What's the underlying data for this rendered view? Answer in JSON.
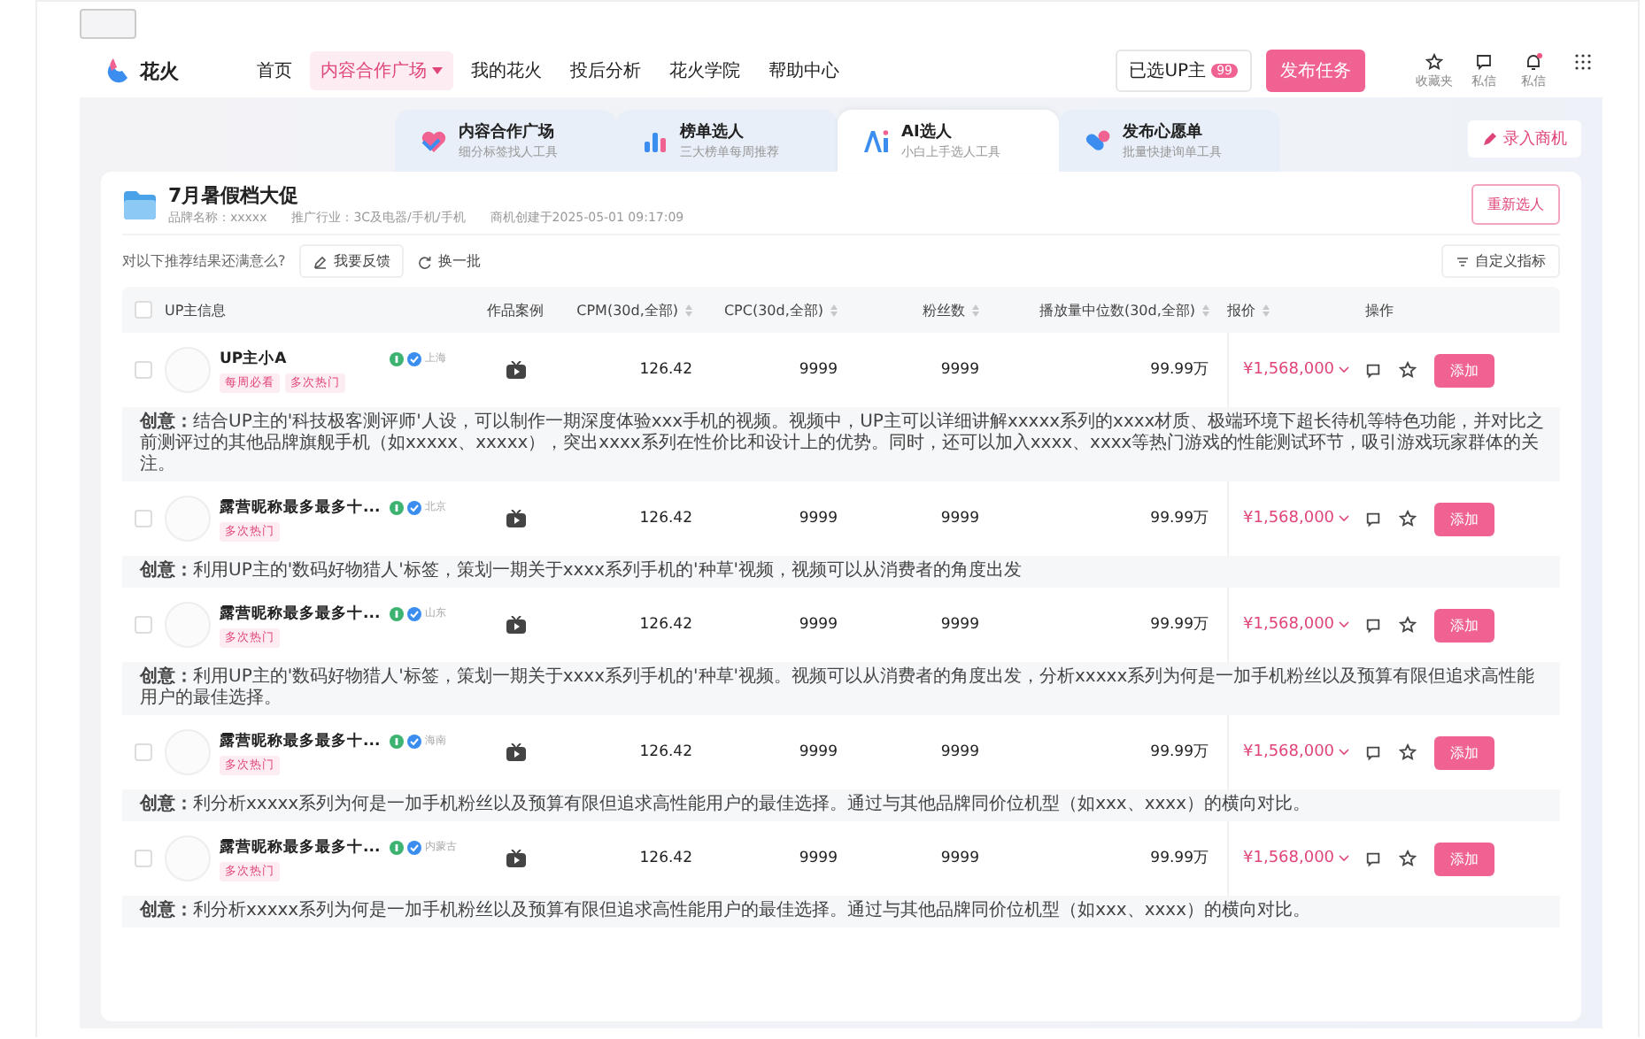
{
  "logo": {
    "name": "花火"
  },
  "nav": [
    {
      "label": "首页",
      "selected": false,
      "dropdown": false
    },
    {
      "label": "内容合作广场",
      "selected": true,
      "dropdown": true
    },
    {
      "label": "我的花火",
      "selected": false,
      "dropdown": false
    },
    {
      "label": "投后分析",
      "selected": false,
      "dropdown": false
    },
    {
      "label": "花火学院",
      "selected": false,
      "dropdown": false
    },
    {
      "label": "帮助中心",
      "selected": false,
      "dropdown": false
    }
  ],
  "selected_creators": {
    "label": "已选UP主",
    "count": "99"
  },
  "publish_button": "发布任务",
  "header_icons": [
    {
      "kind": "star",
      "label": "收藏夹",
      "badge": false
    },
    {
      "kind": "chat",
      "label": "私信",
      "badge": false
    },
    {
      "kind": "bell",
      "label": "私信",
      "badge": true
    },
    {
      "kind": "grid",
      "badge": false
    }
  ],
  "tool_tabs": [
    {
      "kind": "heart",
      "title": "内容合作广场",
      "subtitle": "细分标签找人工具",
      "selected": false
    },
    {
      "kind": "bars",
      "title": "榜单选人",
      "subtitle": "三大榜单每周推荐",
      "selected": false
    },
    {
      "kind": "ai",
      "title": "AI选人",
      "subtitle": "小白上手选人工具",
      "selected": true
    },
    {
      "kind": "pill",
      "title": "发布心愿单",
      "subtitle": "批量快捷询单工具",
      "selected": false
    }
  ],
  "record_button": "录入商机",
  "campaign": {
    "title": "7月暑假档大促",
    "brand": "品牌名称：xxxxx",
    "industry": "推广行业：3C及电器/手机/手机",
    "created": "商机创建于2025-05-01 09:17:09",
    "reselect_button": "重新选人"
  },
  "feedback": {
    "question": "对以下推荐结果还满意么?",
    "feedback_button": "我要反馈",
    "refresh_button": "换一批",
    "custom_button": "自定义指标"
  },
  "table": {
    "columns": [
      {
        "label": "UP主信息",
        "sortable": false
      },
      {
        "label": "作品案例",
        "sortable": false
      },
      {
        "label": "CPM(30d,全部)",
        "sortable": true
      },
      {
        "label": "CPC(30d,全部)",
        "sortable": true
      },
      {
        "label": "粉丝数",
        "sortable": true
      },
      {
        "label": "播放量中位数(30d,全部)",
        "sortable": true
      },
      {
        "label": "报价",
        "sortable": true
      },
      {
        "label": "操作",
        "sortable": false
      }
    ],
    "header_checked": false,
    "rows": [
      {
        "checked": false,
        "name": "UP主小A",
        "location": "上海",
        "tags": [
          "每周必看",
          "多次热门"
        ],
        "cpm": "126.42",
        "cpc": "9999",
        "fans": "9999",
        "plays": "99.99万",
        "price": "¥1,568,000",
        "add": "添加",
        "idea_label": "创意：",
        "idea": "结合UP主的'科技极客测评师'人设，可以制作一期深度体验xxx手机的视频。视频中，UP主可以详细讲解xxxxx系列的xxxx材质、极端环境下超长待机等特色功能，并对比之前测评过的其他品牌旗舰手机（如xxxxx、xxxxx），突出xxxx系列在性价比和设计上的优势。同时，还可以加入xxxx、xxxx等热门游戏的性能测试环节，吸引游戏玩家群体的关注。"
      },
      {
        "checked": false,
        "name": "露营昵称最多最多十...",
        "location": "北京",
        "tags": [
          "多次热门"
        ],
        "cpm": "126.42",
        "cpc": "9999",
        "fans": "9999",
        "plays": "99.99万",
        "price": "¥1,568,000",
        "add": "添加",
        "idea_label": "创意：",
        "idea": "利用UP主的'数码好物猎人'标签，策划一期关于xxxx系列手机的'种草'视频，视频可以从消费者的角度出发"
      },
      {
        "checked": false,
        "name": "露营昵称最多最多十...",
        "location": "山东",
        "tags": [
          "多次热门"
        ],
        "cpm": "126.42",
        "cpc": "9999",
        "fans": "9999",
        "plays": "99.99万",
        "price": "¥1,568,000",
        "add": "添加",
        "idea_label": "创意：",
        "idea": "利用UP主的'数码好物猎人'标签，策划一期关于xxxx系列手机的'种草'视频。视频可以从消费者的角度出发，分析xxxxx系列为何是一加手机粉丝以及预算有限但追求高性能用户的最佳选择。"
      },
      {
        "checked": false,
        "name": "露营昵称最多最多十...",
        "location": "海南",
        "tags": [
          "多次热门"
        ],
        "cpm": "126.42",
        "cpc": "9999",
        "fans": "9999",
        "plays": "99.99万",
        "price": "¥1,568,000",
        "add": "添加",
        "idea_label": "创意：",
        "idea": "利分析xxxxx系列为何是一加手机粉丝以及预算有限但追求高性能用户的最佳选择。通过与其他品牌同价位机型（如xxx、xxxx）的横向对比。"
      },
      {
        "checked": false,
        "name": "露营昵称最多最多十...",
        "location": "内蒙古",
        "tags": [
          "多次热门"
        ],
        "cpm": "126.42",
        "cpc": "9999",
        "fans": "9999",
        "plays": "99.99万",
        "price": "¥1,568,000",
        "add": "添加",
        "idea_label": "创意：",
        "idea": "利分析xxxxx系列为何是一加手机粉丝以及预算有限但追求高性能用户的最佳选择。通过与其他品牌同价位机型（如xxx、xxxx）的横向对比。"
      }
    ]
  }
}
